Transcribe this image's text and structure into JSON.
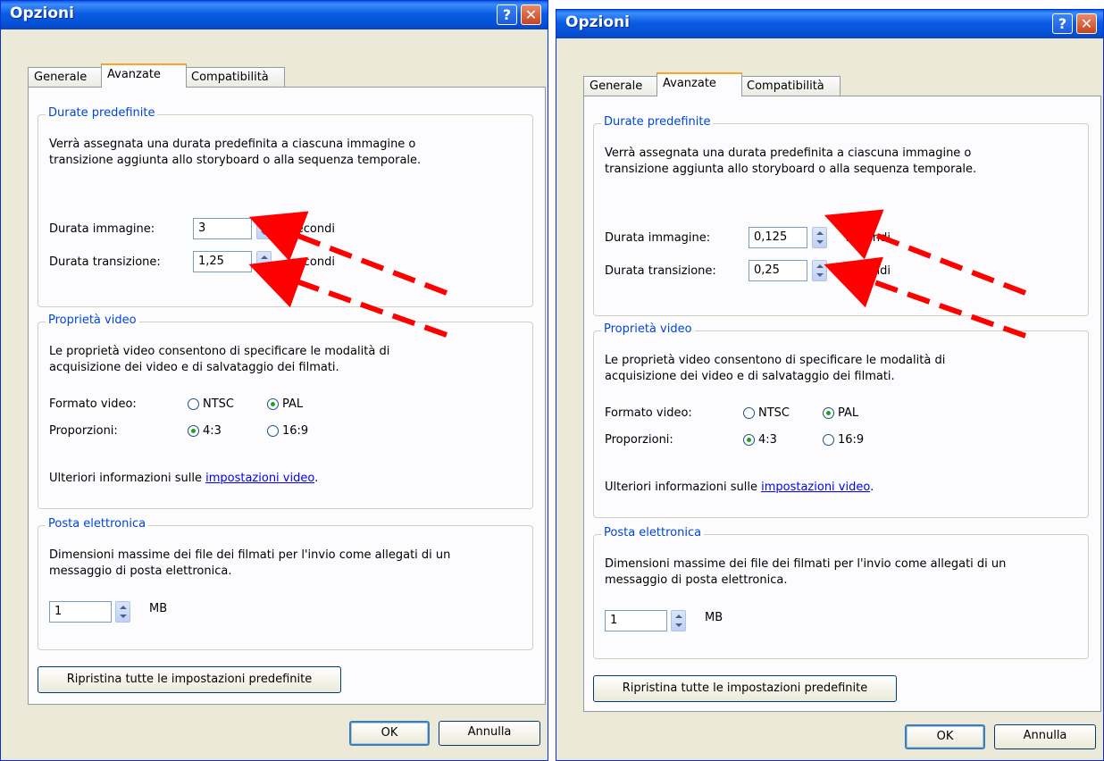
{
  "dialogs": [
    {
      "title": "Opzioni",
      "tabs": [
        "Generale",
        "Avanzate",
        "Compatibilità"
      ],
      "durate": {
        "legend": "Durate predefinite",
        "desc1": "Verrà assegnata una durata predefinita a ciascuna immagine o",
        "desc2": "transizione aggiunta allo storyboard o alla sequenza temporale.",
        "img_label": "Durata immagine:",
        "img_value": "3",
        "trans_label": "Durata transizione:",
        "trans_value": "1,25",
        "unit": "secondi"
      },
      "video": {
        "legend": "Proprietà video",
        "desc1": "Le proprietà video consentono di specificare le modalità di",
        "desc2": "acquisizione dei video e di salvataggio dei filmati.",
        "format_label": "Formato video:",
        "ntsc": "NTSC",
        "pal": "PAL",
        "ratio_label": "Proporzioni:",
        "r43": "4:3",
        "r169": "16:9",
        "info_prefix": "Ulteriori informazioni sulle",
        "info_link": "impostazioni video",
        "info_suffix": "."
      },
      "mail": {
        "legend": "Posta elettronica",
        "desc1": "Dimensioni massime dei  file dei filmati per l'invio come allegati di un",
        "desc2": "messaggio di posta elettronica.",
        "value": "1",
        "unit": "MB"
      },
      "reset": "Ripristina tutte le impostazioni predefinite",
      "ok": "OK",
      "cancel": "Annulla"
    },
    {
      "title": "Opzioni",
      "tabs": [
        "Generale",
        "Avanzate",
        "Compatibilità"
      ],
      "durate": {
        "legend": "Durate predefinite",
        "desc1": "Verrà assegnata una durata predefinita a ciascuna immagine o",
        "desc2": "transizione aggiunta allo storyboard o alla sequenza temporale.",
        "img_label": "Durata immagine:",
        "img_value": "0,125",
        "trans_label": "Durata transizione:",
        "trans_value": "0,25",
        "unit": "secondi"
      },
      "video": {
        "legend": "Proprietà video",
        "desc1": "Le proprietà video consentono di specificare le modalità di",
        "desc2": "acquisizione dei video e di salvataggio dei filmati.",
        "format_label": "Formato video:",
        "ntsc": "NTSC",
        "pal": "PAL",
        "ratio_label": "Proporzioni:",
        "r43": "4:3",
        "r169": "16:9",
        "info_prefix": "Ulteriori informazioni sulle",
        "info_link": "impostazioni video",
        "info_suffix": "."
      },
      "mail": {
        "legend": "Posta elettronica",
        "desc1": "Dimensioni massime dei  file dei filmati per l'invio come allegati di un",
        "desc2": "messaggio di posta elettronica.",
        "value": "1",
        "unit": "MB"
      },
      "reset": "Ripristina tutte le impostazioni predefinite",
      "ok": "OK",
      "cancel": "Annulla"
    }
  ],
  "icons": {
    "help": "help-icon",
    "close": "close-icon"
  },
  "colors": {
    "titlebar": "#0551d6",
    "arrow": "#ff0000",
    "legend": "#0046d5",
    "link": "#0000ff"
  }
}
